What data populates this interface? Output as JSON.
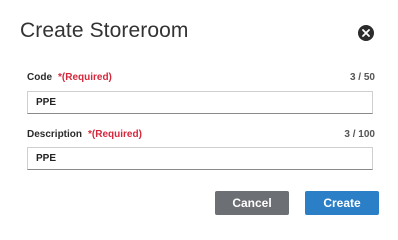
{
  "dialog": {
    "title": "Create Storeroom",
    "close_icon": "close-circle-icon"
  },
  "fields": {
    "code": {
      "label": "Code",
      "required": "*(Required)",
      "counter": "3 / 50",
      "value": "PPE"
    },
    "description": {
      "label": "Description",
      "required": "*(Required)",
      "counter": "3 / 100",
      "value": "PPE"
    }
  },
  "actions": {
    "cancel_label": "Cancel",
    "create_label": "Create"
  },
  "colors": {
    "required": "#d6283c",
    "cancel_bg": "#6c6f74",
    "create_bg": "#2a7fc7"
  }
}
